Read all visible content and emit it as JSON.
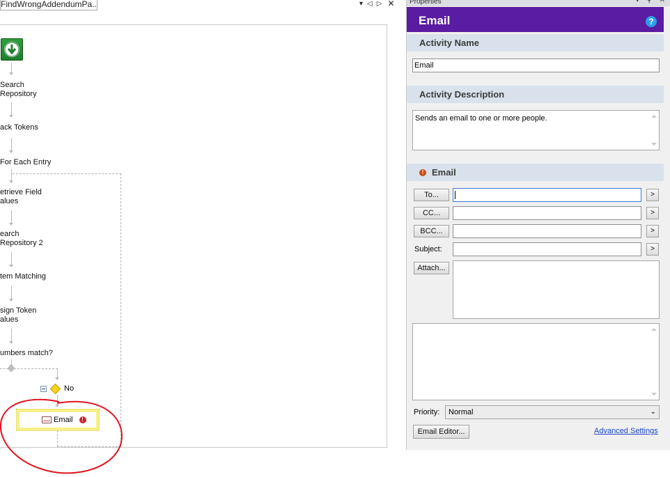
{
  "document": {
    "tab_title": "FindWrongAddendumPa...",
    "tab_controls": {
      "dropdown": "▾",
      "prev": "◁",
      "next": "▷",
      "close": "✕"
    },
    "workflow": {
      "nodes": [
        {
          "label": "Search\nRepository"
        },
        {
          "label": "ack Tokens"
        },
        {
          "label": "For Each Entry"
        },
        {
          "label": "etrieve Field\nalues"
        },
        {
          "label": "earch\nRepository 2"
        },
        {
          "label": "tem Matching"
        },
        {
          "label": "sign Token\nalues"
        },
        {
          "label": "umbers match?"
        }
      ],
      "branch_label": "No",
      "selected_activity": "Email"
    }
  },
  "properties": {
    "window_title": "Properties",
    "window_controls": "▾ ⚲ ✕",
    "header_title": "Email",
    "help_icon": "?",
    "activity_name_label": "Activity Name",
    "activity_name_value": "Email",
    "activity_description_label": "Activity Description",
    "activity_description_value": "Sends an email to one or more people.",
    "email_section_label": "Email",
    "to_button": "To...",
    "cc_button": "CC...",
    "bcc_button": "BCC...",
    "subject_label": "Subject:",
    "attach_button": "Attach...",
    "more_arrow": ">",
    "priority_label": "Priority:",
    "priority_value": "Normal",
    "email_editor_button": "Email Editor...",
    "advanced_settings_link": "Advanced Settings"
  },
  "colors": {
    "header_bg": "#5a1ca2",
    "section_bg": "#d9e2ec",
    "annotation_red": "#e0141e",
    "link_blue": "#1a47c4"
  }
}
